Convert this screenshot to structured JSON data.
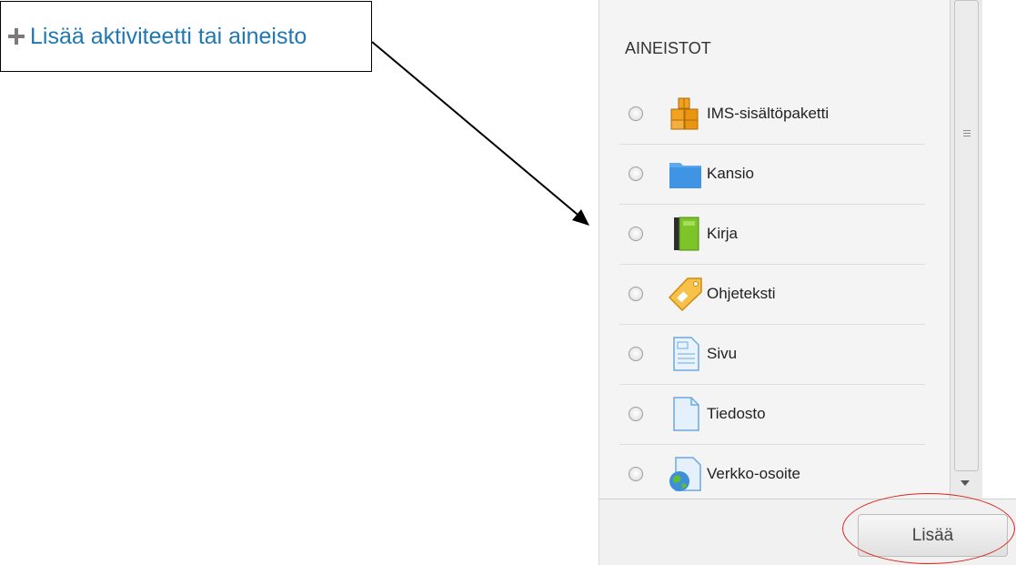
{
  "callout": {
    "link_label": "Lisää aktiviteetti tai aineisto",
    "icon": "plus-icon"
  },
  "panel": {
    "section_title": "AINEISTOT",
    "options": [
      {
        "label": "IMS-sisältöpaketti",
        "icon": "ims-package-icon"
      },
      {
        "label": "Kansio",
        "icon": "folder-icon"
      },
      {
        "label": "Kirja",
        "icon": "book-icon"
      },
      {
        "label": "Ohjeteksti",
        "icon": "label-tag-icon"
      },
      {
        "label": "Sivu",
        "icon": "page-icon"
      },
      {
        "label": "Tiedosto",
        "icon": "file-icon"
      },
      {
        "label": "Verkko-osoite",
        "icon": "url-globe-icon"
      }
    ]
  },
  "footer": {
    "add_button_label": "Lisää"
  },
  "colors": {
    "link": "#1f78b4",
    "highlight": "#d9261c"
  }
}
